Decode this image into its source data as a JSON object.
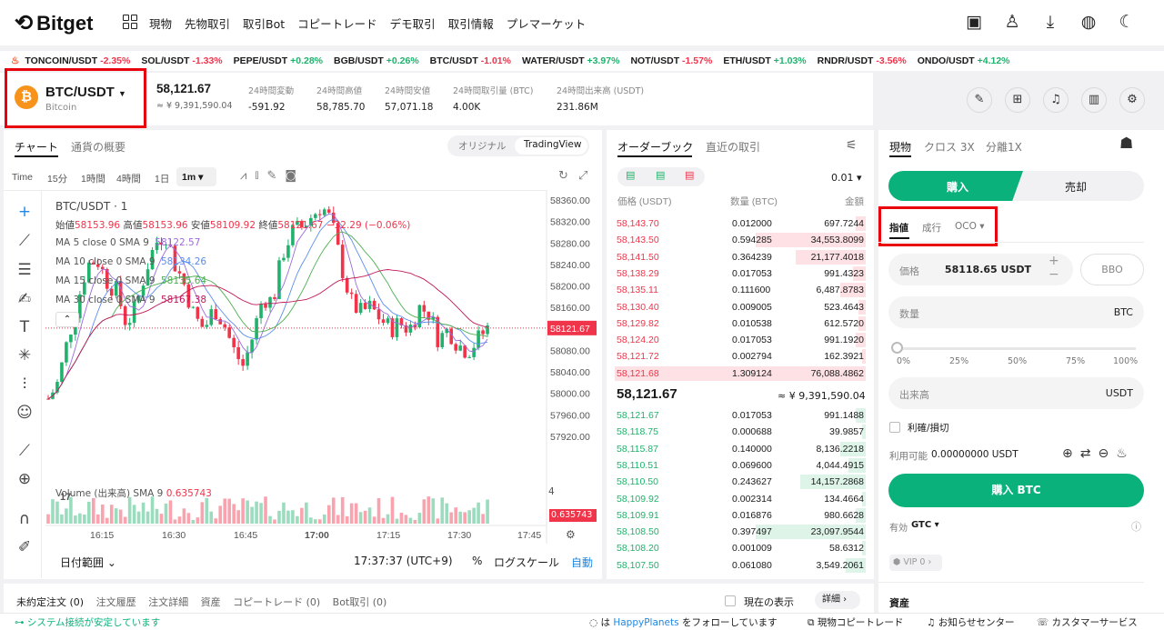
{
  "nav": {
    "logo": "Bitget",
    "menu": [
      "現物",
      "先物取引",
      "取引Bot",
      "コピートレード",
      "デモ取引",
      "取引情報",
      "プレマーケット"
    ]
  },
  "ticker": [
    {
      "pair": "TONCOIN/USDT",
      "chg": "-2.35%",
      "dir": "dn"
    },
    {
      "pair": "SOL/USDT",
      "chg": "-1.33%",
      "dir": "dn"
    },
    {
      "pair": "PEPE/USDT",
      "chg": "+0.28%",
      "dir": "up"
    },
    {
      "pair": "BGB/USDT",
      "chg": "+0.26%",
      "dir": "up"
    },
    {
      "pair": "BTC/USDT",
      "chg": "-1.01%",
      "dir": "dn"
    },
    {
      "pair": "WATER/USDT",
      "chg": "+3.97%",
      "dir": "up"
    },
    {
      "pair": "NOT/USDT",
      "chg": "-1.57%",
      "dir": "dn"
    },
    {
      "pair": "ETH/USDT",
      "chg": "+1.03%",
      "dir": "up"
    },
    {
      "pair": "RNDR/USDT",
      "chg": "-3.56%",
      "dir": "dn"
    },
    {
      "pair": "ONDO/USDT",
      "chg": "+4.12%",
      "dir": "up"
    }
  ],
  "pair": {
    "symbol": "BTC/USDT",
    "name": "Bitcoin",
    "price": "58,121.67",
    "fiat": "≈ ¥ 9,391,590.04",
    "stats": [
      {
        "label": "24時間変動",
        "value": "-591.92"
      },
      {
        "label": "24時間高値",
        "value": "58,785.70"
      },
      {
        "label": "24時間安値",
        "value": "57,071.18"
      },
      {
        "label": "24時間取引量 (BTC)",
        "value": "4.00K"
      },
      {
        "label": "24時間出来高 (USDT)",
        "value": "231.86M"
      }
    ]
  },
  "chart": {
    "tabs": [
      "チャート",
      "通貨の概要"
    ],
    "modes": [
      "オリジナル",
      "TradingView"
    ],
    "intervals": [
      "Time",
      "15分",
      "1時間",
      "4時間",
      "1日",
      "1m"
    ],
    "title": "BTC/USDT · 1",
    "ohlc": {
      "o_l": "始値",
      "o": "58153.96",
      "h_l": "高値",
      "h": "58153.96",
      "l_l": "安値",
      "l": "58109.92",
      "c_l": "終値",
      "c": "58121.67",
      "chg": "−32.29 (−0.06%)"
    },
    "ma": [
      {
        "label": "MA 5 close 0 SMA 9",
        "value": "58122.57",
        "color": "#9c6ade"
      },
      {
        "label": "MA 10 close 0 SMA 9",
        "value": "58134.26",
        "color": "#5b8def"
      },
      {
        "label": "MA 15 close 0 SMA 9",
        "value": "58135.64",
        "color": "#4caf50"
      },
      {
        "label": "MA 30 close 0 SMA 9",
        "value": "58167.38",
        "color": "#c2185b"
      }
    ],
    "yticks": [
      "58360.00",
      "58320.00",
      "58280.00",
      "58240.00",
      "58200.00",
      "58160.00",
      "58121.67",
      "58080.00",
      "58040.00",
      "58000.00",
      "57960.00",
      "57920.00"
    ],
    "current": "58121.67",
    "volume": {
      "label": "Volume (出来高) SMA 9",
      "value": "0.635743",
      "tick": "4"
    },
    "xticks": [
      "16:15",
      "16:30",
      "16:45",
      "17:00",
      "17:15",
      "17:30",
      "17:45"
    ],
    "footer": {
      "range": "日付範囲",
      "time": "17:37:37 (UTC+9)",
      "pct": "%",
      "log": "ログスケール",
      "auto": "自動"
    }
  },
  "orderbook": {
    "tabs": [
      "オーダーブック",
      "直近の取引"
    ],
    "precision": "0.01",
    "headers": [
      "価格 (USDT)",
      "数量 (BTC)",
      "金額"
    ],
    "asks": [
      {
        "p": "58,143.70",
        "q": "0.012000",
        "a": "697.7244",
        "d": 0.04
      },
      {
        "p": "58,143.50",
        "q": "0.594285",
        "a": "34,553.8099",
        "d": 0.44
      },
      {
        "p": "58,141.50",
        "q": "0.364239",
        "a": "21,177.4018",
        "d": 0.28
      },
      {
        "p": "58,138.29",
        "q": "0.017053",
        "a": "991.4323",
        "d": 0.05
      },
      {
        "p": "58,135.11",
        "q": "0.111600",
        "a": "6,487.8783",
        "d": 0.1
      },
      {
        "p": "58,130.40",
        "q": "0.009005",
        "a": "523.4643",
        "d": 0.03
      },
      {
        "p": "58,129.82",
        "q": "0.010538",
        "a": "612.5720",
        "d": 0.03
      },
      {
        "p": "58,124.20",
        "q": "0.017053",
        "a": "991.1920",
        "d": 0.04
      },
      {
        "p": "58,121.72",
        "q": "0.002794",
        "a": "162.3921",
        "d": 0.01
      },
      {
        "p": "58,121.68",
        "q": "1.309124",
        "a": "76,088.4862",
        "d": 1
      }
    ],
    "mid": "58,121.67",
    "mid_fiat": "≈ ¥ 9,391,590.04",
    "bids": [
      {
        "p": "58,121.67",
        "q": "0.017053",
        "a": "991.1488",
        "d": 0.04
      },
      {
        "p": "58,118.75",
        "q": "0.000688",
        "a": "39.9857",
        "d": 0.01
      },
      {
        "p": "58,115.87",
        "q": "0.140000",
        "a": "8,136.2218",
        "d": 0.1
      },
      {
        "p": "58,110.51",
        "q": "0.069600",
        "a": "4,044.4915",
        "d": 0.07
      },
      {
        "p": "58,110.50",
        "q": "0.243627",
        "a": "14,157.2868",
        "d": 0.26
      },
      {
        "p": "58,109.92",
        "q": "0.002314",
        "a": "134.4664",
        "d": 0.01
      },
      {
        "p": "58,109.91",
        "q": "0.016876",
        "a": "980.6628",
        "d": 0.04
      },
      {
        "p": "58,108.50",
        "q": "0.397497",
        "a": "23,097.9544",
        "d": 0.44
      },
      {
        "p": "58,108.20",
        "q": "0.001009",
        "a": "58.6312",
        "d": 0.01
      },
      {
        "p": "58,107.50",
        "q": "0.061080",
        "a": "3,549.2061",
        "d": 0.08
      }
    ]
  },
  "trade": {
    "tabs": [
      "現物",
      "クロス 3X",
      "分離1X"
    ],
    "buy": "購入",
    "sell": "売却",
    "types": [
      "指値",
      "成行",
      "OCO"
    ],
    "price_label": "価格",
    "price_value": "58118.65 USDT",
    "bbo": "BBO",
    "qty_label": "数量",
    "qty_unit": "BTC",
    "slider": [
      "0%",
      "25%",
      "50%",
      "75%",
      "100%"
    ],
    "total_label": "出来高",
    "total_unit": "USDT",
    "tpsl": "利確/損切",
    "avail_label": "利用可能",
    "avail_value": "0.00000000 USDT",
    "buy_btn": "購入 BTC",
    "tif_label": "有効",
    "tif": "GTC",
    "vip": "VIP 0",
    "assets": "資産"
  },
  "bottom": {
    "tabs": [
      "未約定注文 (0)",
      "注文履歴",
      "注文詳細",
      "資産",
      "コピートレード (0)",
      "Bot取引 (0)"
    ],
    "show_current": "現在の表示",
    "details": "詳細",
    "status": "システム接続が安定しています",
    "follow_pre": "は",
    "follow_name": "HappyPlanets",
    "follow_post": "をフォローしています",
    "links": [
      "現物コピートレード",
      "お知らせセンター",
      "カスタマーサービス"
    ]
  },
  "colors": {
    "up": "#20b26c",
    "down": "#f0344a",
    "accent": "#0ab17b",
    "highlight": "#e8000c"
  }
}
